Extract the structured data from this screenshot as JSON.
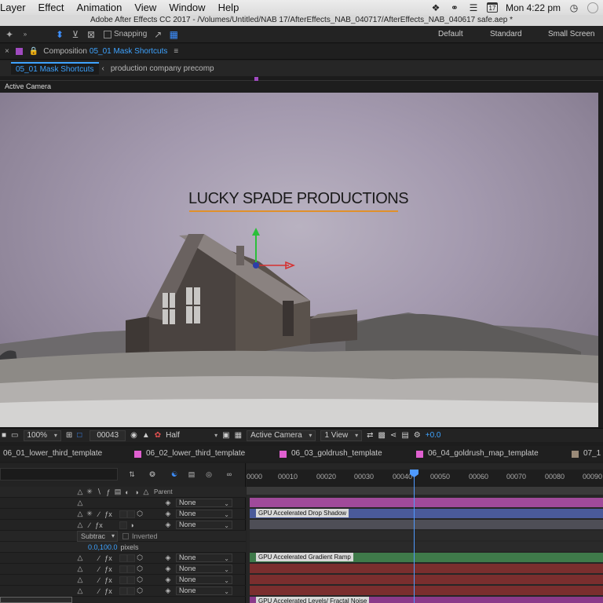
{
  "menubar": {
    "items": [
      "Layer",
      "Effect",
      "Animation",
      "View",
      "Window",
      "Help"
    ],
    "calendar_day": "17",
    "clock": "Mon 4:22 pm"
  },
  "window_title": "Adobe After Effects CC 2017 - /Volumes/Untitled/NAB 17/AfterEffects_NAB_040717/AfterEffects_NAB_040617 safe.aep *",
  "toolbar": {
    "snapping_label": "Snapping",
    "workspaces": [
      "Default",
      "Standard",
      "Small Screen"
    ]
  },
  "composition_panel": {
    "label": "Composition",
    "comp_name": "05_01 Mask Shortcuts",
    "breadcrumbs": [
      "05_01 Mask Shortcuts",
      "production company precomp"
    ],
    "active_camera_label": "Active Camera"
  },
  "viewer": {
    "scene_title": "LUCKY SPADE PRODUCTIONS",
    "accent_color": "#e0902a"
  },
  "view_bar": {
    "zoom": "100%",
    "timecode": "00043",
    "resolution": "Half",
    "camera": "Active Camera",
    "views": "1 View",
    "exposure": "+0.0"
  },
  "comp_tabs": [
    {
      "label": "06_01_lower_third_template",
      "color": "#e060d0"
    },
    {
      "label": "06_02_lower_third_template",
      "color": "#e060d0"
    },
    {
      "label": "06_03_goldrush_template",
      "color": "#e060d0"
    },
    {
      "label": "06_04_goldrush_map_template",
      "color": "#e060d0"
    },
    {
      "label": "07_1",
      "color": "#9a8a78"
    }
  ],
  "timeline": {
    "ruler_ticks": [
      "0000",
      "00010",
      "00020",
      "00030",
      "00040",
      "00050",
      "00060",
      "00070",
      "00080",
      "00090"
    ],
    "parent_header": "Parent",
    "parent_value": "None",
    "mask_mode": "Subtrac",
    "inverted_label": "Inverted",
    "feather_value": "0.0,100.0",
    "feather_unit": "pixels",
    "bar_labels": {
      "drop_shadow": "GPU Accelerated Drop Shadow",
      "gradient_ramp": "GPU Accelerated Gradient Ramp",
      "levels_noise": "GPU Accelerated Levels/ Fractal Noise"
    },
    "colors": {
      "pink_bar": "#a04a9a",
      "blue_bar": "#4a5a9a",
      "green_bar": "#3f7a4a",
      "red_bar": "#7a2e2e",
      "purple_bar": "#8a3a8a"
    }
  }
}
